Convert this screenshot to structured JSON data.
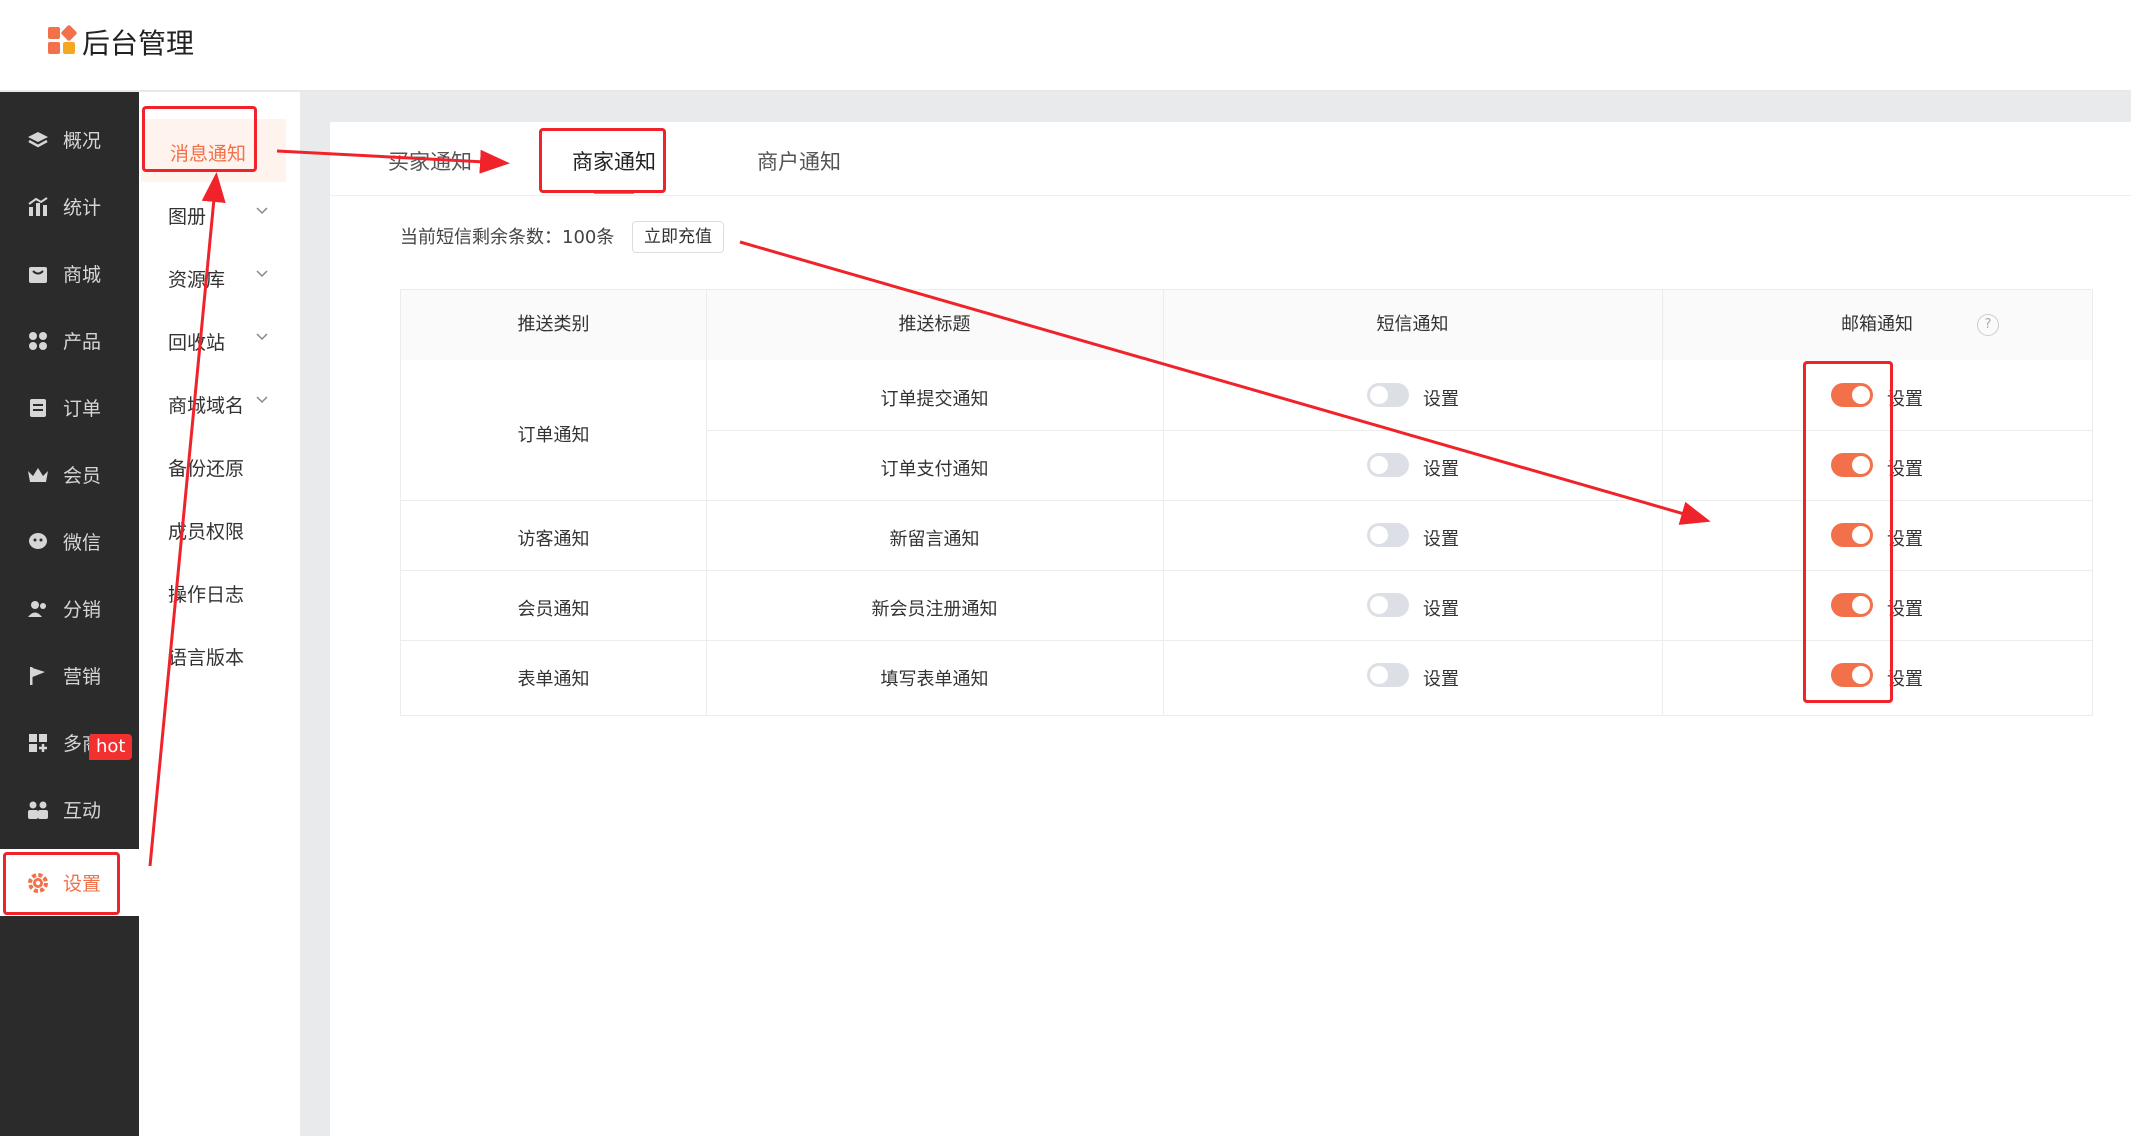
{
  "header": {
    "title": "后台管理"
  },
  "colors": {
    "accent": "#f2704a",
    "annotation": "#f0232a",
    "sidebar_bg": "#2b2b2b"
  },
  "sidebar": {
    "items": [
      {
        "label": "概况",
        "icon": "layers-icon"
      },
      {
        "label": "统计",
        "icon": "chart-icon"
      },
      {
        "label": "商城",
        "icon": "shop-icon"
      },
      {
        "label": "产品",
        "icon": "grid-icon"
      },
      {
        "label": "订单",
        "icon": "order-icon"
      },
      {
        "label": "会员",
        "icon": "crown-icon"
      },
      {
        "label": "微信",
        "icon": "wechat-icon"
      },
      {
        "label": "分销",
        "icon": "users-icon"
      },
      {
        "label": "营销",
        "icon": "flag-icon",
        "badge": "hot"
      },
      {
        "label": "多商户",
        "icon": "multi-shop-icon"
      },
      {
        "label": "互动",
        "icon": "interact-icon"
      },
      {
        "label": "设置",
        "icon": "gear-icon",
        "active": true
      }
    ]
  },
  "submenu": {
    "items": [
      {
        "label": "消息通知",
        "active": true,
        "expandable": false
      },
      {
        "label": "图册",
        "expandable": true
      },
      {
        "label": "资源库",
        "expandable": true
      },
      {
        "label": "回收站",
        "expandable": true
      },
      {
        "label": "商城域名",
        "expandable": true
      },
      {
        "label": "备份还原",
        "expandable": false
      },
      {
        "label": "成员权限",
        "expandable": false
      },
      {
        "label": "操作日志",
        "expandable": false
      },
      {
        "label": "语言版本",
        "expandable": false
      }
    ]
  },
  "tabs": [
    {
      "label": "买家通知"
    },
    {
      "label": "商家通知",
      "active": true
    },
    {
      "label": "商户通知"
    }
  ],
  "sms": {
    "remaining_text": "当前短信剩余条数：100条",
    "recharge_label": "立即充值"
  },
  "table": {
    "headers": [
      "推送类别",
      "推送标题",
      "短信通知",
      "邮箱通知"
    ],
    "setting_label": "设置",
    "groups": [
      {
        "category": "订单通知",
        "rows": [
          {
            "title": "订单提交通知",
            "sms": false,
            "email": true
          },
          {
            "title": "订单支付通知",
            "sms": false,
            "email": true
          }
        ]
      },
      {
        "category": "访客通知",
        "rows": [
          {
            "title": "新留言通知",
            "sms": false,
            "email": true
          }
        ]
      },
      {
        "category": "会员通知",
        "rows": [
          {
            "title": "新会员注册通知",
            "sms": false,
            "email": true
          }
        ]
      },
      {
        "category": "表单通知",
        "rows": [
          {
            "title": "填写表单通知",
            "sms": false,
            "email": true
          }
        ]
      }
    ]
  }
}
